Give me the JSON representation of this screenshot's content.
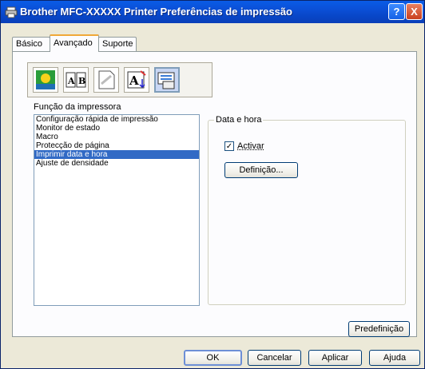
{
  "window": {
    "title": "Brother MFC-XXXXX Printer Preferências de impressão",
    "help_label": "?",
    "close_label": "X"
  },
  "tabs": [
    {
      "label": "Básico"
    },
    {
      "label": "Avançado"
    },
    {
      "label": "Suporte"
    }
  ],
  "toolbar_icons": [
    "print-quality-icon",
    "duplex-icon",
    "watermark-icon",
    "page-setting-icon",
    "device-options-icon"
  ],
  "printer_function": {
    "label": "Função da impressora",
    "items": [
      "Configuração rápida de impressão",
      "Monitor de estado",
      "Macro",
      "Protecção de página",
      "Imprimir data e hora",
      "Ajuste de densidade"
    ],
    "selected_index": 4
  },
  "date_time": {
    "title": "Data e hora",
    "enable_label": "Activar",
    "enable_checked": true,
    "settings_button": "Definição..."
  },
  "footer": {
    "default_button": "Predefinição",
    "ok": "OK",
    "cancel": "Cancelar",
    "apply": "Aplicar",
    "help": "Ajuda"
  },
  "colors": {
    "titlebar": "#0a5ce6",
    "selection": "#316ac5",
    "tab_highlight": "#f0a838"
  }
}
